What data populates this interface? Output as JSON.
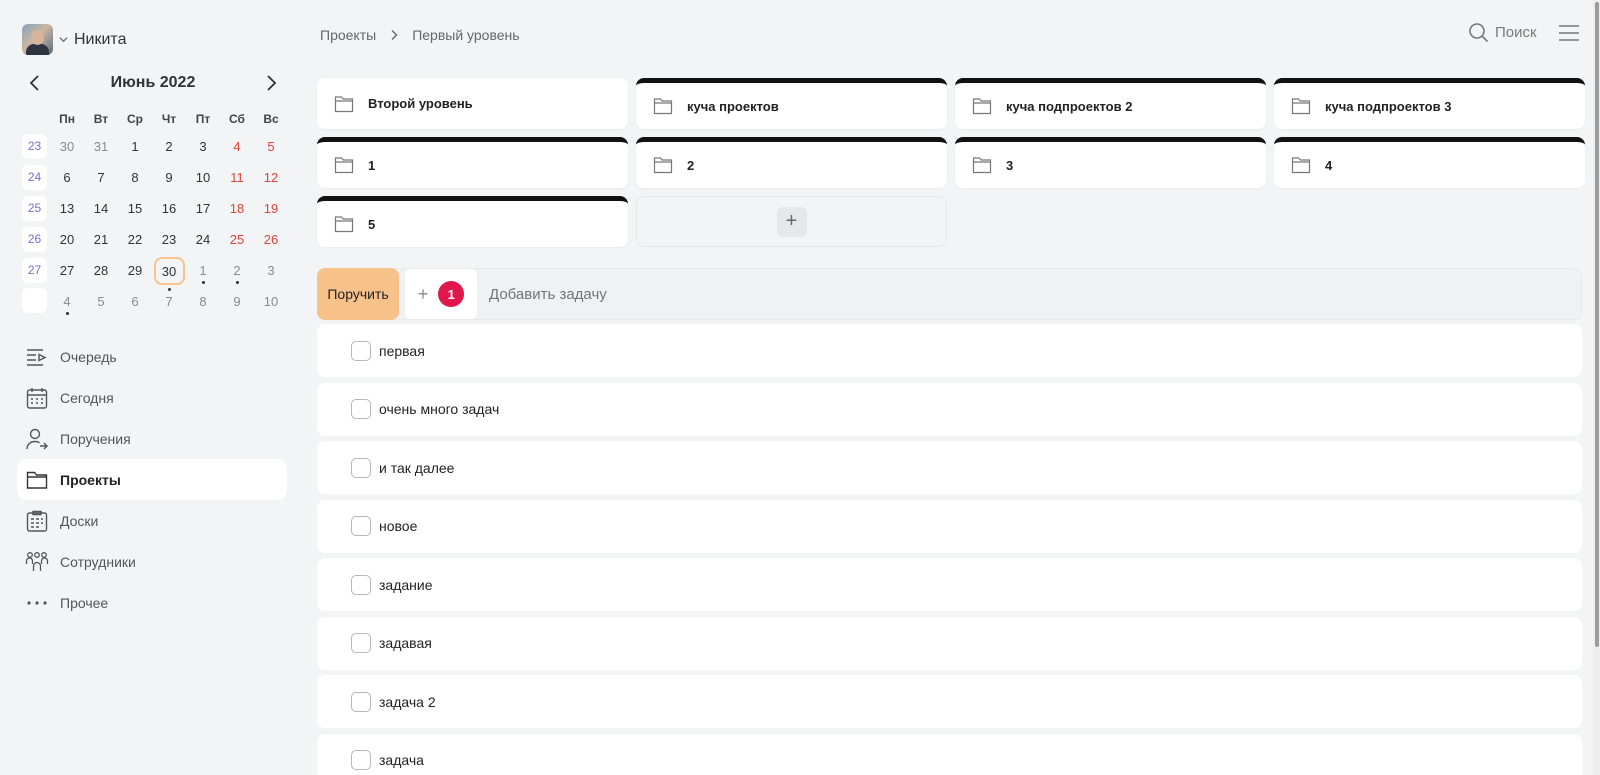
{
  "user": {
    "name": "Никита"
  },
  "calendar": {
    "title": "Июнь 2022",
    "weekdays": [
      "Пн",
      "Вт",
      "Ср",
      "Чт",
      "Пт",
      "Сб",
      "Вс"
    ],
    "weeks": [
      {
        "num": "23",
        "days": [
          "30",
          "31",
          "1",
          "2",
          "3",
          "4",
          "5"
        ]
      },
      {
        "num": "24",
        "days": [
          "6",
          "7",
          "8",
          "9",
          "10",
          "11",
          "12"
        ]
      },
      {
        "num": "25",
        "days": [
          "13",
          "14",
          "15",
          "16",
          "17",
          "18",
          "19"
        ]
      },
      {
        "num": "26",
        "days": [
          "20",
          "21",
          "22",
          "23",
          "24",
          "25",
          "26"
        ]
      },
      {
        "num": "27",
        "days": [
          "27",
          "28",
          "29",
          "30",
          "1",
          "2",
          "3"
        ]
      },
      {
        "num": "",
        "days": [
          "4",
          "5",
          "6",
          "7",
          "8",
          "9",
          "10"
        ]
      }
    ],
    "today": "30",
    "colors": {
      "weekend": "#e0433a",
      "week_number": "#7b6bd6",
      "today_ring": "#f6c48c"
    }
  },
  "nav": {
    "items": [
      {
        "label": "Очередь",
        "icon": "queue-icon"
      },
      {
        "label": "Сегодня",
        "icon": "calendar-icon"
      },
      {
        "label": "Поручения",
        "icon": "user-assign-icon"
      },
      {
        "label": "Проекты",
        "icon": "folder-icon"
      },
      {
        "label": "Доски",
        "icon": "board-icon"
      },
      {
        "label": "Сотрудники",
        "icon": "team-icon"
      },
      {
        "label": "Прочее",
        "icon": "more-icon"
      }
    ],
    "active": "Проекты"
  },
  "breadcrumb": {
    "root": "Проекты",
    "current": "Первый уровень"
  },
  "header": {
    "search_label": "Поиск"
  },
  "projects": [
    {
      "name": "Второй уровень"
    },
    {
      "name": "куча проектов"
    },
    {
      "name": "куча подпроектов 2"
    },
    {
      "name": "куча подпроектов 3"
    },
    {
      "name": "1"
    },
    {
      "name": "2"
    },
    {
      "name": "3"
    },
    {
      "name": "4"
    },
    {
      "name": "5"
    }
  ],
  "task_bar": {
    "assign_label": "Поручить",
    "badge_count": "1",
    "placeholder": "Добавить задачу",
    "colors": {
      "assign": "#f7c18a",
      "badge": "#e0174c"
    }
  },
  "tasks": [
    {
      "title": "первая"
    },
    {
      "title": "очень много задач"
    },
    {
      "title": "и так далее"
    },
    {
      "title": "новое"
    },
    {
      "title": "задание"
    },
    {
      "title": "задавая"
    },
    {
      "title": "задача 2"
    },
    {
      "title": "задача"
    }
  ]
}
